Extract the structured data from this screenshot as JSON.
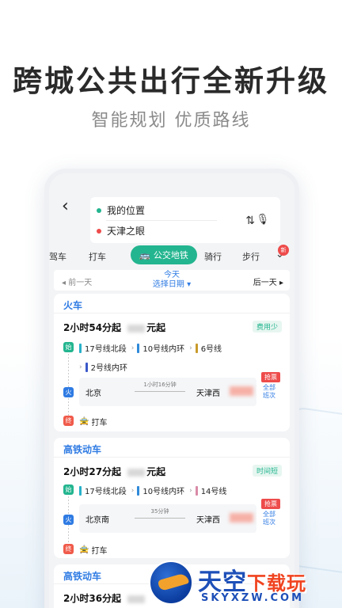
{
  "promo": {
    "headline": "跨城公共出行全新升级",
    "subline": "智能规划  优质路线"
  },
  "search": {
    "origin": "我的位置",
    "destination": "天津之眼",
    "origin_color": "#23b58f",
    "destination_color": "#ee4b4b",
    "back_icon": "back-arrow-icon",
    "swap_icon": "swap-icon",
    "mic_icon": "mic-icon"
  },
  "modes": {
    "items": [
      "驾车",
      "打车",
      "公交地铁",
      "骑行",
      "步行"
    ],
    "active": "公交地铁",
    "new_badge": "新"
  },
  "datebar": {
    "prev": "前一天",
    "today": "今天",
    "pick": "选择日期",
    "next": "后一天"
  },
  "routes": [
    {
      "category": "火车",
      "duration": "2小时54分起",
      "price_suffix": "元起",
      "tag": "费用少",
      "start_mark": "始",
      "end_mark": "终",
      "rail_mark": "火",
      "lines": [
        {
          "name": "17号线北段",
          "color": "#28b1c9"
        },
        {
          "name": "10号线内环",
          "color": "#2f8ad9"
        },
        {
          "name": "6号线",
          "color": "#c79a2b"
        },
        {
          "name": "2号线内环",
          "color": "#3a58c9"
        }
      ],
      "from": "北京",
      "to": "天津西",
      "ride_time": "1小时16分钟",
      "sale_tag": "抢票",
      "all_link": "全部班次",
      "taxi": "打车"
    },
    {
      "category": "高铁动车",
      "duration": "2小时27分起",
      "price_suffix": "元起",
      "tag": "时间短",
      "start_mark": "始",
      "end_mark": "终",
      "rail_mark": "火",
      "lines": [
        {
          "name": "17号线北段",
          "color": "#28b1c9"
        },
        {
          "name": "10号线内环",
          "color": "#2f8ad9"
        },
        {
          "name": "14号线",
          "color": "#d98aa7"
        }
      ],
      "from": "北京南",
      "to": "天津西",
      "ride_time": "35分钟",
      "sale_tag": "抢票",
      "all_link": "全部班次",
      "taxi": "打车"
    },
    {
      "category": "高铁动车",
      "duration": "2小时36分起"
    }
  ],
  "watermark": {
    "cn_main": "天空",
    "cn_accent": "下载玩",
    "en": "SKYXZW.COM"
  }
}
